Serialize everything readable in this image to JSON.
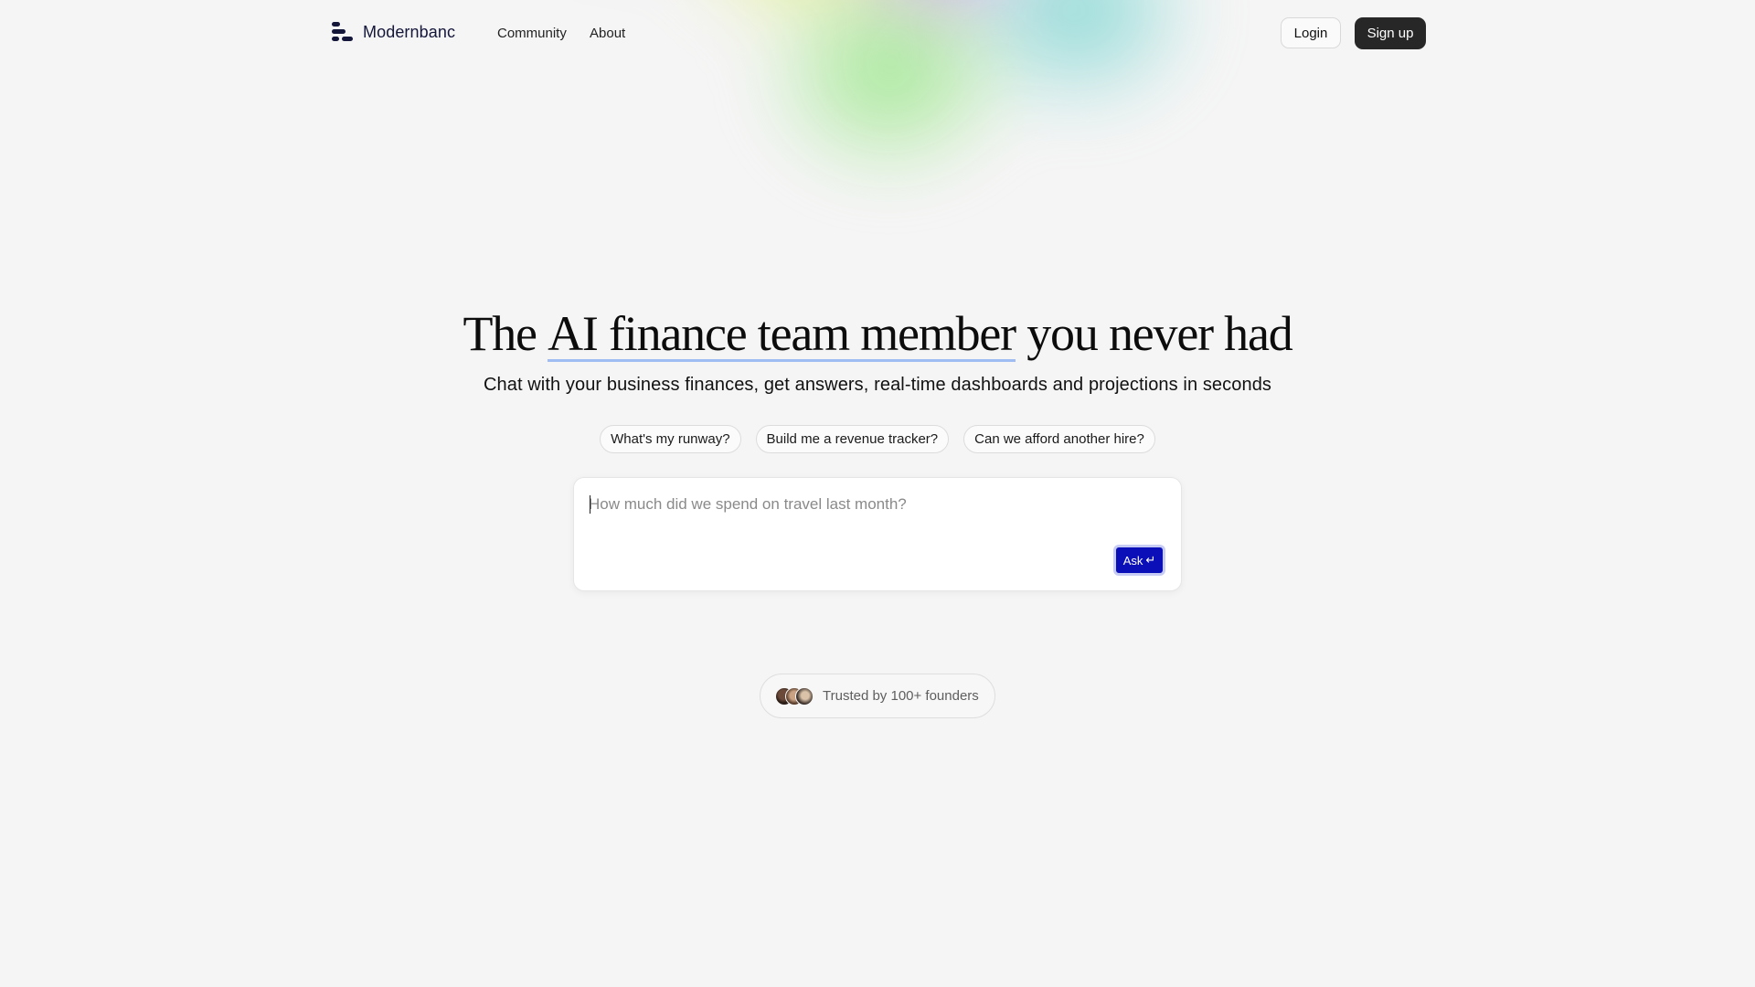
{
  "brand": {
    "name": "Modernbanc",
    "logo_icon": "stacked-bars-logo-icon"
  },
  "nav": {
    "links": [
      "Community",
      "About"
    ],
    "login_label": "Login",
    "signup_label": "Sign up"
  },
  "hero": {
    "title_before": "The ",
    "title_highlight": "AI finance team member",
    "title_after": " you never had",
    "subtitle": "Chat with your business finances, get answers, real-time dashboards and projections in seconds"
  },
  "suggestions": [
    "What's my runway?",
    "Build me a revenue tracker?",
    "Can we afford another hire?"
  ],
  "ask": {
    "placeholder": "How much did we spend on travel last month?",
    "value": "",
    "button_label": "Ask",
    "button_icon": "↵"
  },
  "trusted": {
    "text": "Trusted by 100+ founders",
    "avatar_count": 3
  },
  "colors": {
    "background": "#f5f5f5",
    "ask_button": "#0b0fb7",
    "signup_button": "#272727",
    "highlight_underline": "#9fbdf2",
    "brand_text": "#14163a"
  }
}
